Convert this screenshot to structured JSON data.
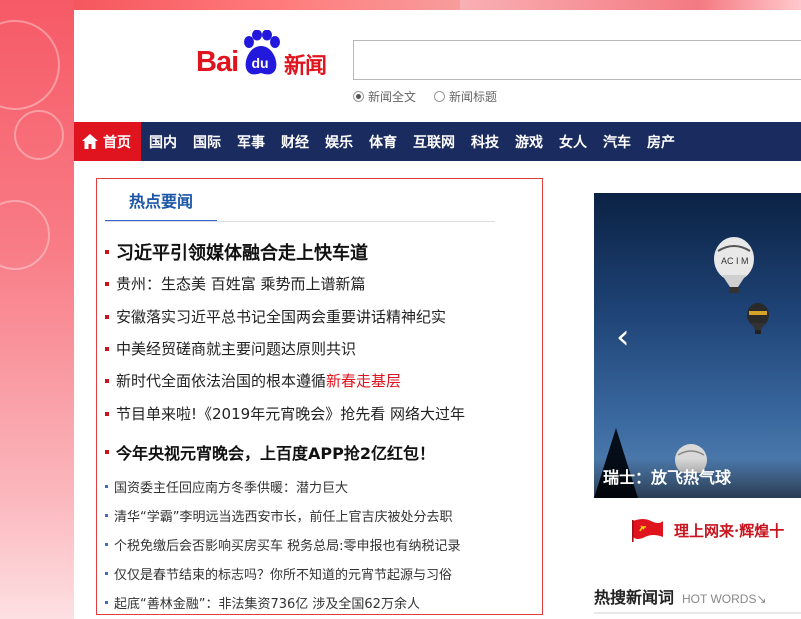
{
  "logo": {
    "bai": "Bai",
    "du": "du",
    "xinwen": "新闻"
  },
  "search": {
    "value": "",
    "placeholder": ""
  },
  "search_options": [
    {
      "label": "新闻全文",
      "selected": true
    },
    {
      "label": "新闻标题",
      "selected": false
    }
  ],
  "nav": {
    "home": "首页",
    "items": [
      "国内",
      "国际",
      "军事",
      "财经",
      "娱乐",
      "体育",
      "互联网",
      "科技",
      "游戏",
      "女人",
      "汽车",
      "房产"
    ]
  },
  "hot_news": {
    "tab": "热点要闻",
    "items": [
      {
        "text": "习近平引领媒体融合走上快车道",
        "extra": ""
      },
      {
        "text": "贵州：生态美 百姓富 乘势而上谱新篇",
        "extra": ""
      },
      {
        "text": "安徽落实习近平总书记全国两会重要讲话精神纪实",
        "extra": ""
      },
      {
        "text": "中美经贸磋商就主要问题达原则共识",
        "extra": ""
      },
      {
        "text": "新时代全面依法治国的根本遵循 ",
        "extra": "新春走基层"
      },
      {
        "text": "节目单来啦!《2019年元宵晚会》抢先看  网络大过年",
        "extra": ""
      },
      {
        "text": "今年央视元宵晚会，上百度APP抢2亿红包！",
        "extra": ""
      },
      {
        "text": "国资委主任回应南方冬季供暖：潜力巨大",
        "extra": ""
      },
      {
        "text": "清华“学霸”李明远当选西安市长，前任上官吉庆被处分去职",
        "extra": ""
      },
      {
        "text": "个税免缴后会否影响买房买车 税务总局:零申报也有纳税记录",
        "extra": ""
      },
      {
        "text": "仅仅是春节结束的标志吗？你所不知道的元宵节起源与习俗",
        "extra": ""
      },
      {
        "text": "起底“善林金融”：非法集资736亿 涉及全国62万余人",
        "extra": ""
      }
    ]
  },
  "carousel": {
    "prev": "‹",
    "caption": "瑞士：放飞热气球"
  },
  "banner": {
    "text": "理上网来·辉煌十"
  },
  "hot_words": {
    "title": "热搜新闻词",
    "subtitle": "HOT WORDS↘"
  },
  "colors": {
    "brand_red": "#e0141e",
    "nav_blue": "#1a2b5f",
    "link_blue": "#1a55a8"
  }
}
